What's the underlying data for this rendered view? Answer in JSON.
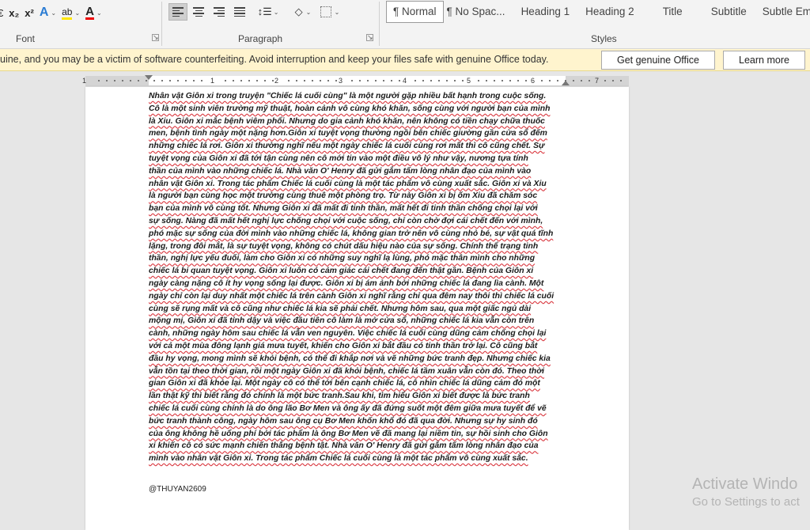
{
  "ribbon": {
    "font_group": {
      "subscript": "x₂",
      "superscript": "x²",
      "label": "Font"
    },
    "paragraph_group": {
      "label": "Paragraph"
    },
    "styles_group": {
      "label": "Styles",
      "items": [
        "¶ Normal",
        "¶ No Spac...",
        "Heading 1",
        "Heading 2",
        "Title",
        "Subtitle",
        "Subtle Em"
      ]
    }
  },
  "message_bar": {
    "text": "uine, and you may be a victim of software counterfeiting. Avoid interruption and keep your files safe with genuine Office today.",
    "primary_button": "Get genuine Office",
    "secondary_button": "Learn more"
  },
  "ruler": {
    "numbers": [
      "1",
      "1",
      "2",
      "3",
      "4",
      "5",
      "6",
      "7"
    ]
  },
  "document": {
    "lines": [
      "Nhân vật Giôn xi trong truyện \"Chiếc lá cuối cùng\" là một người gặp nhiều bất hạnh trong cuộc sống.",
      "Cô là một sinh viên trường mỹ thuật, hoàn cảnh vô cùng khó khăn, sống cùng với người bạn của mình",
      "là Xiu. Giôn xi mắc bệnh viêm phổi. Nhưng do gia cảnh khó khăn, nên không có tiền chạy chữa thuốc",
      "men, bệnh tình ngày một nặng hơn.Giôn xi tuyệt vọng thường ngồi bên chiếc giường gần cửa sổ đếm",
      "những chiếc lá rơi. Giôn xi thường nghĩ nếu một ngày chiếc lá cuối cùng rơi mất thì cô cũng chết. Sự",
      "tuyệt vọng của Giôn xi đã tới tận cùng nên cô mới tin vào một điều vô lý như vậy, nương tựa tính",
      "thần của mình vào những chiếc lá. Nhà văn O' Henry đã gửi gắm tấm lòng nhân đạo của mình vào",
      "nhân vật Giôn xi. Trong tác phẩm Chiếc lá cuối cùng là một tác phẩm vô cùng xuất sắc. Giôn xi và Xiu",
      "là người bạn cùng học một trường cùng thuê một phòng trọ. Từ này Giôn xi bị ốm Xiu đã chăm sóc",
      "bạn của mình vô cùng tốt. Nhưng Giôn xi đã mất đi tinh thần, mất hết đi tinh thần chống chọi lại với",
      "sự sống. Nàng đã mất hết nghị lực chống chọi với cuộc sống, chỉ còn chờ đợi cái chết đến với mình,",
      "phó mặc sự sống của đời mình vào những chiếc lá, không gian trở nên vô cùng nhỏ bé, sự vật quá tĩnh",
      "lặng, trong đôi mắt, là sự tuyệt vọng, không có chút dấu hiệu nào của sự sống. Chính thể trạng tinh",
      "thần, nghị lực yếu đuối, làm cho Giôn xi có những suy nghĩ lạ lùng, phó mặc thân mình cho những",
      "chiếc lá bi quan tuyệt vọng. Giôn xi luôn có cảm giác cái chết đang đến thật gần. Bệnh của Giôn xi",
      "ngày càng nặng cô ít hy vọng sống lại được. Giôn xi bị ám ảnh bởi những chiếc lá đang lìa cành. Một",
      "ngày chỉ còn lại duy nhất một chiếc lá trên cành Giôn xi nghĩ rằng chỉ qua đêm nay thôi thì chiếc lá cuối",
      "cùng sẽ rụng mất và cô cũng như chiếc lá kia sẽ phải chết. Nhưng hôm sau, qua một giấc ngủ dài",
      "mộng mị, Giôn xi đã tỉnh dậy và việc đầu tiên cô làm là mở cửa sổ, những chiếc lá kia vẫn còn trên",
      "cành, những ngày hôm sau chiếc lá vẫn ven nguyên. Việc chiếc lá cuối cùng dũng cảm chống chọi lại",
      "với cả một mùa đông lạnh giá mưa tuyết, khiến cho Giôn xi bắt đầu có tinh thần trở lại. Cô cũng bắt",
      "đầu hy vọng, mong mình sẽ khỏi bệnh, có thể đi khắp nơi và vẽ những bức tranh đẹp. Nhưng chiếc kia",
      "vẫn tồn tại theo thời gian, rồi một ngày Giôn xi đã khỏi bệnh, chiếc lá tầm xuân vẫn còn đó. Theo thời",
      "gian Giôn xi đã khỏe lại. Một ngày cô có thể tới bên cạnh chiếc lá, cô nhìn chiếc lá dũng cảm đó một",
      "lần thật kỹ thì biết rằng đó chính là một bức tranh.Sau khi, tìm hiểu Giôn xi biết được là bức tranh",
      "chiếc lá cuối cùng chính là do ông lão Bơ Men và ông ấy đã đứng suốt một đêm giữa mưa tuyết để vẽ",
      "bức tranh thành công, ngày hôm sau ông cụ Bơ Men khốn khổ đó đã qua đời. Nhưng sự hy sinh đó",
      "của ông không hề uổng phí bởi tác phẩm là ông Bơ Men vẽ đã mang lại niềm tin, sự hồi sinh cho Giôn",
      "xi khiến cô có sức mạnh chiến thắng bệnh tật. Nhà văn O' Henry đã gửi gắm tấm lòng nhân đạo của",
      "mình vào nhân vật Giôn xi. Trong tác phẩm Chiếc lá cuối cùng là một tác phẩm vô cùng xuất sắc."
    ],
    "signature": "@THUYAN2609"
  },
  "watermark": {
    "line1": "Activate Windo",
    "line2": "Go to Settings to act"
  },
  "colors": {
    "ribbon_bg": "#f3f3f3",
    "message_bg": "#fff4ce",
    "spellcheck_red": "#d9363e"
  }
}
